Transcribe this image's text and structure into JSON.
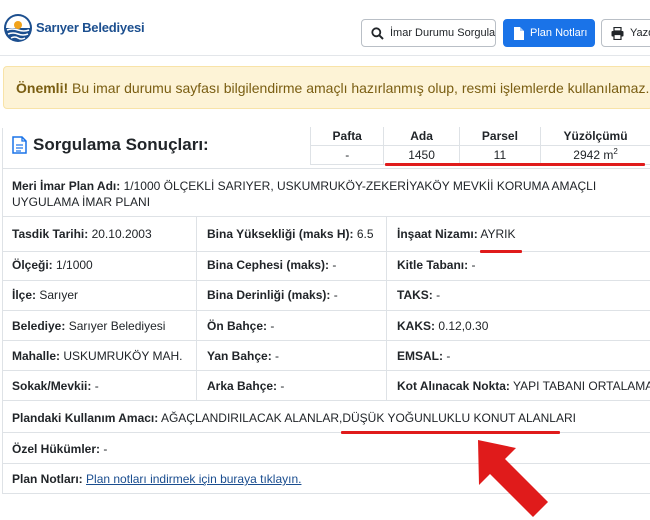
{
  "header": {
    "brand": "Sarıyer Belediyesi",
    "buttons": {
      "imar": "İmar Durumu Sorgula",
      "plan": "Plan Notları",
      "print": "Yazdır"
    },
    "icons": [
      "logo-icon",
      "search-icon",
      "document-icon",
      "printer-icon"
    ]
  },
  "alert": {
    "strong": "Önemli!",
    "text": " Bu imar durumu sayfası bilgilendirme amaçlı hazırlanmış olup, resmi işlemlerde kullanılamaz."
  },
  "results": {
    "title": "Sorgulama Sonuçları:",
    "summary": {
      "headers": [
        "Pafta",
        "Ada",
        "Parsel",
        "Yüzölçümü"
      ],
      "values": [
        "-",
        "1450",
        "11",
        "2942 m"
      ],
      "area_unit_sup": "2"
    }
  },
  "plan_name": {
    "label": "Meri İmar Plan Adı:",
    "value": " 1/1000 ÖLÇEKLİ SARIYER, USKUMRUKÖY-ZEKERİYAKÖY MEVKİİ KORUMA AMAÇLI UYGULAMA İMAR PLANI"
  },
  "rows": [
    [
      {
        "label": "Tasdik Tarihi:",
        "value": " 20.10.2003"
      },
      {
        "label": "Bina Yüksekliği (maks H):",
        "value": " 6.5"
      },
      {
        "label": "İnşaat Nizamı:",
        "value": " AYRIK"
      }
    ],
    [
      {
        "label": "Ölçeği:",
        "value": " 1/1000"
      },
      {
        "label": "Bina Cephesi (maks):",
        "value": " -"
      },
      {
        "label": "Kitle Tabanı:",
        "value": " -"
      }
    ],
    [
      {
        "label": "İlçe:",
        "value": " Sarıyer"
      },
      {
        "label": "Bina Derinliği (maks):",
        "value": " -"
      },
      {
        "label": "TAKS:",
        "value": " -"
      }
    ],
    [
      {
        "label": "Belediye:",
        "value": " Sarıyer Belediyesi"
      },
      {
        "label": "Ön Bahçe:",
        "value": " -"
      },
      {
        "label": "KAKS:",
        "value": " 0.12,0.30"
      }
    ],
    [
      {
        "label": "Mahalle:",
        "value": " USKUMRUKÖY MAH."
      },
      {
        "label": "Yan Bahçe:",
        "value": " -"
      },
      {
        "label": "EMSAL:",
        "value": " -"
      }
    ],
    [
      {
        "label": "Sokak/Mevkii:",
        "value": " -"
      },
      {
        "label": "Arka Bahçe:",
        "value": " -"
      },
      {
        "label": "Kot Alınacak Nokta:",
        "value": " YAPI TABANI ORTALAMASI"
      }
    ]
  ],
  "usage": {
    "label": "Plandaki Kullanım Amacı:",
    "value": " AĞAÇLANDIRILACAK ALANLAR,DÜŞÜK YOĞUNLUKLU KONUT ALANLARI"
  },
  "special": {
    "label": "Özel Hükümler:",
    "value": " -"
  },
  "notes": {
    "label": "Plan Notları:",
    "link": "Plan notları indirmek için buraya tıklayın."
  },
  "annotation_color": "#e01b1b"
}
